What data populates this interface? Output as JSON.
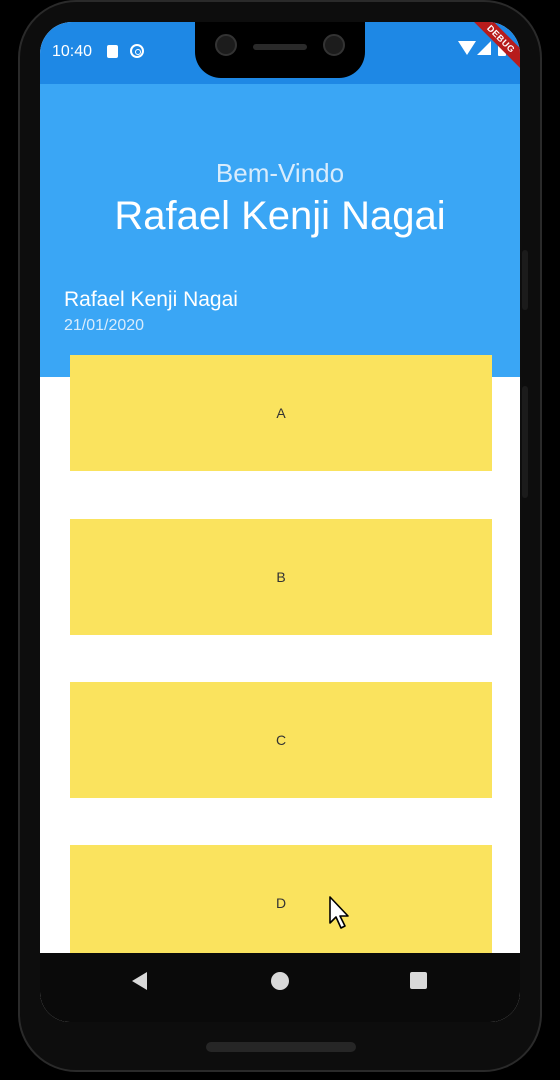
{
  "status_bar": {
    "time": "10:40",
    "debug_label": "DEBUG",
    "color": "#1e88e5"
  },
  "header": {
    "welcome": "Bem-Vindo",
    "title": "Rafael Kenji Nagai",
    "color": "#3aa6f5"
  },
  "profile": {
    "name": "Rafael Kenji Nagai",
    "date": "21/01/2020"
  },
  "cards": [
    {
      "label": "A"
    },
    {
      "label": "B"
    },
    {
      "label": "C"
    },
    {
      "label": "D"
    }
  ],
  "colors": {
    "card": "#fae35e",
    "debug_banner": "#b71c1c"
  },
  "icons": {
    "status": [
      "sd-card-icon",
      "sync-icon",
      "wifi-icon",
      "signal-icon",
      "battery-icon"
    ],
    "nav": [
      "back-icon",
      "home-icon",
      "recents-icon"
    ],
    "pointer": "cursor-icon"
  }
}
